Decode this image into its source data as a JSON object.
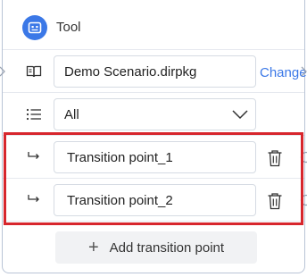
{
  "header": {
    "title": "Tool",
    "icon": "robot-icon",
    "accent": "#3b78e7"
  },
  "scenario": {
    "file": "Demo Scenario.dirpkg",
    "change_label": "Change",
    "icon": "book-icon"
  },
  "filter": {
    "value": "All",
    "icon": "list-icon"
  },
  "transitions": [
    {
      "name": "Transition point_1"
    },
    {
      "name": "Transition point_2"
    }
  ],
  "add_button": {
    "label": "Add transition point"
  },
  "highlight_color": "#d7262d"
}
